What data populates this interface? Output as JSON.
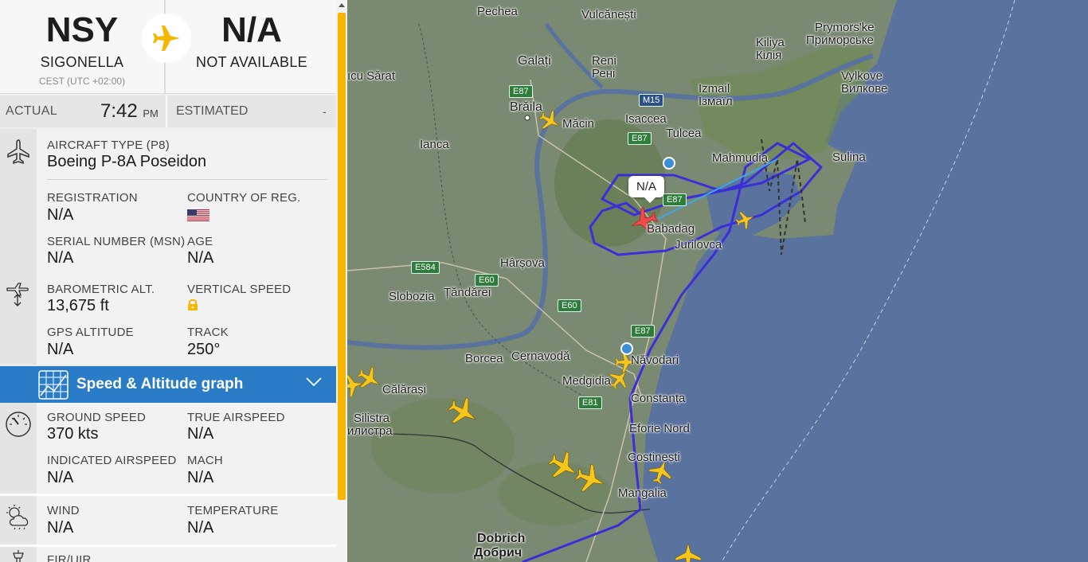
{
  "route": {
    "origin": {
      "code": "NSY",
      "name": "SIGONELLA",
      "timezone": "CEST (UTC +02:00)"
    },
    "destination": {
      "code": "N/A",
      "name": "NOT AVAILABLE"
    }
  },
  "times": {
    "actual_label": "ACTUAL",
    "actual_value": "7:42",
    "actual_ampm": "PM",
    "estimated_label": "ESTIMATED",
    "estimated_value": "-"
  },
  "aircraft": {
    "type_label": "AIRCRAFT TYPE (P8)",
    "type_value": "Boeing P-8A Poseidon",
    "registration_label": "REGISTRATION",
    "registration_value": "N/A",
    "country_label": "COUNTRY OF REG.",
    "country_flag": "us-flag-icon",
    "serial_label": "SERIAL NUMBER (MSN)",
    "serial_value": "N/A",
    "age_label": "AGE",
    "age_value": "N/A"
  },
  "altitude": {
    "baro_label": "BAROMETRIC ALT.",
    "baro_value": "13,675 ft",
    "vspeed_label": "VERTICAL SPEED",
    "vspeed_icon": "lock-icon",
    "gps_label": "GPS ALTITUDE",
    "gps_value": "N/A",
    "track_label": "TRACK",
    "track_value": "250°"
  },
  "graph": {
    "label": "Speed & Altitude graph"
  },
  "speed": {
    "ground_label": "GROUND SPEED",
    "ground_value": "370 kts",
    "tas_label": "TRUE AIRSPEED",
    "tas_value": "N/A",
    "ias_label": "INDICATED AIRSPEED",
    "ias_value": "N/A",
    "mach_label": "MACH",
    "mach_value": "N/A"
  },
  "weather": {
    "wind_label": "WIND",
    "wind_value": "N/A",
    "temp_label": "TEMPERATURE",
    "temp_value": "N/A"
  },
  "fir": {
    "label": "FIR/UIR"
  },
  "map": {
    "selected_label": "N/A",
    "places": {
      "pechea": "Pechea",
      "vulcanesti": "Vulcănești",
      "galati": "Galați",
      "reni": "Reni",
      "reni_cyr": "Рені",
      "kiliya": "Kiliya",
      "kiliya_cyr": "Кілія",
      "prymorske": "Prymors'ke",
      "prymorske_cyr": "Приморське",
      "ucu_sarat": "ıcu Sărat",
      "braila": "Brăila",
      "macin": "Măcin",
      "izmail": "Izmail",
      "izmail_cyr": "Ізмаїл",
      "vylkove": "Vylkove",
      "vylkove_cyr": "Вилкове",
      "isaccea": "Isaccea",
      "tulcea": "Tulcea",
      "ianca": "Ianca",
      "mahmudia": "Mahmudia",
      "sulina": "Sulina",
      "babadag": "Babadag",
      "jurilovca": "Jurilovca",
      "harsova": "Hârșova",
      "slobozia": "Slobozia",
      "tandarei": "Țăndărei",
      "borcea": "Borcea",
      "cernavoda": "Cernavodă",
      "navodari": "Năvodari",
      "medgidia": "Medgidia",
      "calarasi": "Călărași",
      "constanta": "Constanța",
      "silistra": "Silistra",
      "silistra_cyr": "илистра",
      "eforie": "Eforie Nord",
      "costinesti": "Costinești",
      "mangalia": "Mangalia",
      "dobrich": "Dobrich",
      "dobrich_cyr": "Добрич"
    },
    "roads": {
      "e87a": "E87",
      "m15": "M15",
      "e87b": "E87",
      "e87c": "E87",
      "e584": "E584",
      "e60a": "E60",
      "e60b": "E60",
      "e87d": "E87",
      "e81": "E81"
    }
  }
}
